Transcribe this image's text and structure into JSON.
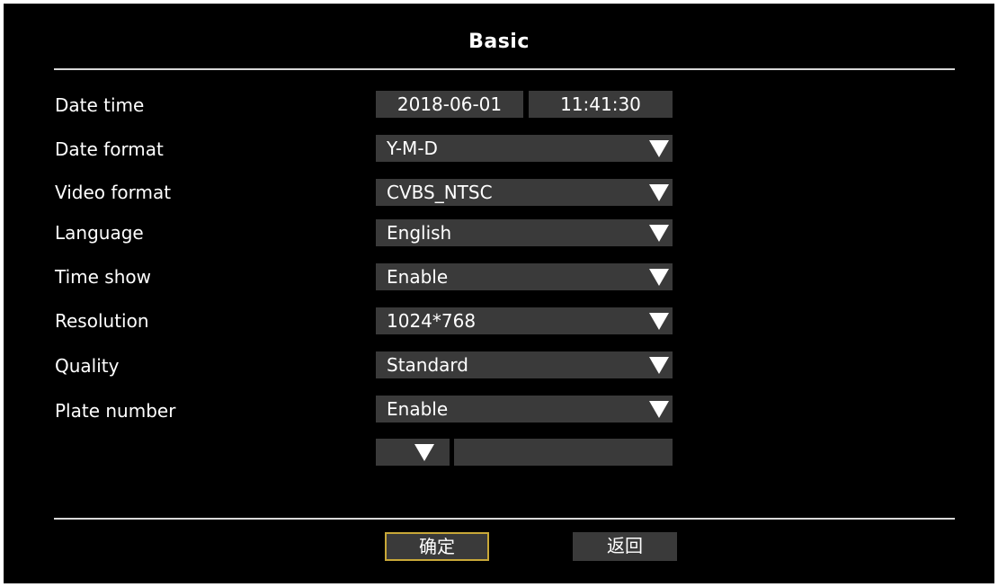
{
  "title": "Basic",
  "rows": {
    "date_time": {
      "label": "Date time",
      "date": "2018-06-01",
      "time": "11:41:30"
    },
    "date_format": {
      "label": "Date format",
      "value": "Y-M-D"
    },
    "video_format": {
      "label": "Video format",
      "value": "CVBS_NTSC"
    },
    "language": {
      "label": "Language",
      "value": "English"
    },
    "time_show": {
      "label": "Time show",
      "value": "Enable"
    },
    "resolution": {
      "label": "Resolution",
      "value": "1024*768"
    },
    "quality": {
      "label": "Quality",
      "value": "Standard"
    },
    "plate_number": {
      "label": "Plate number",
      "value": "Enable",
      "prefix_value": "",
      "text_value": ""
    }
  },
  "buttons": {
    "confirm": "确定",
    "back": "返回"
  },
  "colors": {
    "background": "#000000",
    "field": "#3a3a3a",
    "text": "#ffffff",
    "focus_border": "#c8a838",
    "divider": "#d8d8d8"
  }
}
